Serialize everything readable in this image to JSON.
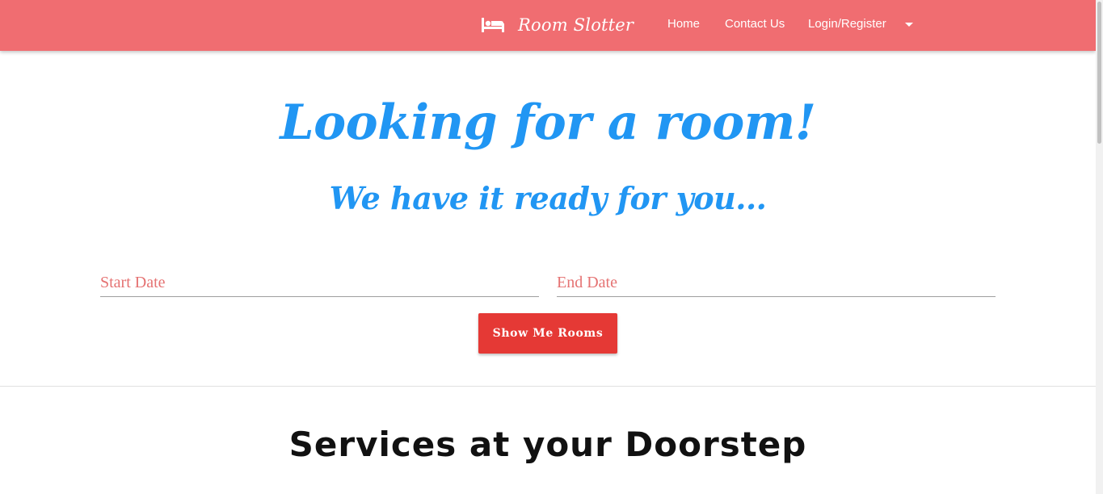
{
  "navbar": {
    "brand_name": "Room Slotter",
    "brand_icon": "bed-icon",
    "links": {
      "home": "Home",
      "contact": "Contact Us",
      "login": "Login/Register"
    },
    "dropdown_icon": "caret-down-icon",
    "background_color": "#f06d71"
  },
  "hero": {
    "title": "Looking for a room!",
    "subtitle": "We have it ready for you...",
    "accent_color": "#2196f3"
  },
  "search": {
    "start_placeholder": "Start Date",
    "end_placeholder": "End Date",
    "start_value": "",
    "end_value": "",
    "button_label": "Show Me Rooms",
    "button_color": "#e53935"
  },
  "services": {
    "title": "Services at your Doorstep"
  }
}
